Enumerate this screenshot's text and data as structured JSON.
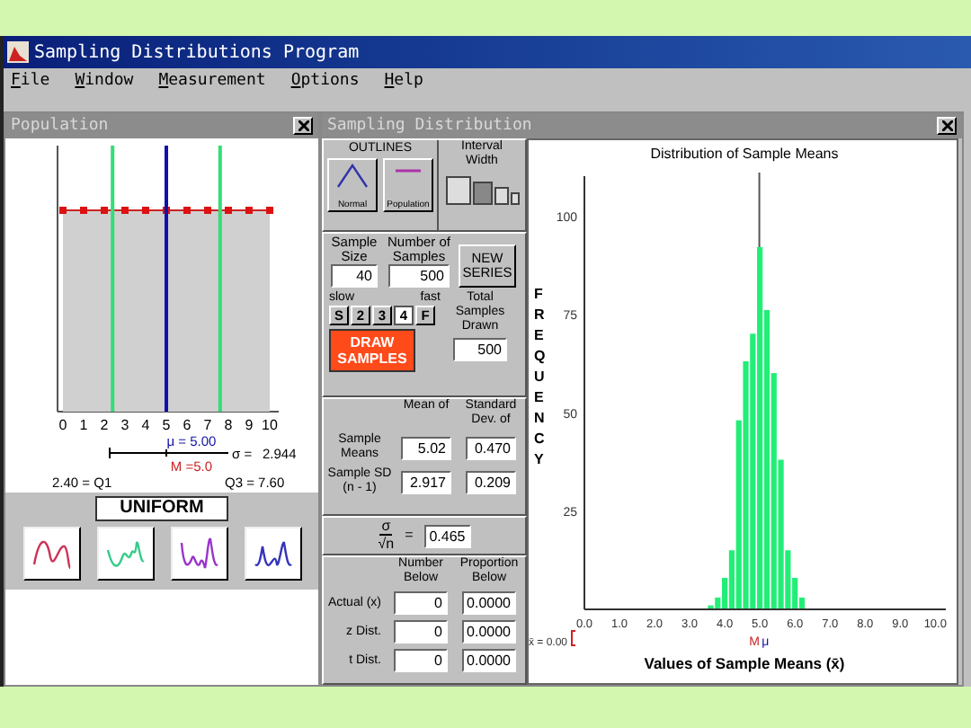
{
  "app": {
    "title": "Sampling Distributions Program"
  },
  "menu": [
    "File",
    "Window",
    "Measurement",
    "Options",
    "Help"
  ],
  "population": {
    "title": "Population",
    "axis_labels": [
      "0",
      "1",
      "2",
      "3",
      "4",
      "5",
      "6",
      "7",
      "8",
      "9",
      "10"
    ],
    "mu_label": "μ = 5.00",
    "sigma_label": "σ =",
    "sigma_value": "2.944",
    "median_label": "M =5.0",
    "q1_label": "2.40 = Q1",
    "q3_label": "Q3 = 7.60",
    "shape_name": "UNIFORM",
    "shape_buttons": [
      {
        "color": "#cc3355"
      },
      {
        "color": "#33cc88"
      },
      {
        "color": "#9933cc"
      },
      {
        "color": "#3333bb"
      }
    ]
  },
  "sampling": {
    "title": "Sampling Distribution",
    "outlines": {
      "label": "OUTLINES",
      "buttons": [
        {
          "label": "Normal",
          "kind": "curve"
        },
        {
          "label": "Population",
          "kind": "flat"
        }
      ]
    },
    "interval": {
      "label": "Interval Width",
      "options": [
        {
          "selected": false
        },
        {
          "selected": true
        },
        {
          "selected": false
        },
        {
          "selected": false
        }
      ]
    },
    "sample_size": {
      "label": "Sample Size",
      "value": "40"
    },
    "num_samples": {
      "label": "Number of Samples",
      "value": "500"
    },
    "new_series": "NEW SERIES",
    "speed": {
      "slow": "slow",
      "fast": "fast",
      "buttons": [
        {
          "label": "S",
          "selected": false
        },
        {
          "label": "2",
          "selected": false
        },
        {
          "label": "3",
          "selected": false
        },
        {
          "label": "4",
          "selected": true
        },
        {
          "label": "F",
          "selected": false
        }
      ]
    },
    "draw": "DRAW SAMPLES",
    "total": {
      "label": "Total Samples Drawn",
      "value": "500"
    },
    "stats": {
      "columns": [
        "Mean of",
        "Standard Dev. of"
      ],
      "rows": [
        {
          "label": "Sample Means",
          "values": [
            "5.02",
            "0.470"
          ]
        },
        {
          "label": "Sample SD (n - 1)",
          "values": [
            "2.917",
            "0.209"
          ]
        }
      ]
    },
    "se": {
      "numerator": "σ",
      "denominator": "√n",
      "equals": "=",
      "value": "0.465"
    },
    "below": {
      "columns": [
        "Number Below",
        "Proportion Below"
      ],
      "rows": [
        {
          "label": "Actual (x)",
          "values": [
            "0",
            "0.0000"
          ]
        },
        {
          "label": "z Dist.",
          "values": [
            "0",
            "0.0000"
          ]
        },
        {
          "label": "t Dist.",
          "values": [
            "0",
            "0.0000"
          ]
        }
      ]
    },
    "chart": {
      "start_label": "x̄ = 0.00",
      "median_mark": "M",
      "mean_mark": "μ",
      "chart_data": {
        "type": "bar",
        "title": "Distribution of Sample Means",
        "xlabel": "Values of Sample Means (x̄)",
        "ylabel": "FREQUENCY",
        "x": [
          3.6,
          3.8,
          4.0,
          4.2,
          4.4,
          4.6,
          4.8,
          5.0,
          5.2,
          5.4,
          5.6,
          5.8,
          6.0,
          6.2
        ],
        "values": [
          1,
          3,
          8,
          15,
          48,
          63,
          70,
          92,
          76,
          60,
          38,
          15,
          8,
          3
        ],
        "xlim": [
          0,
          10.3
        ],
        "ylim": [
          0,
          110
        ],
        "xticks": [
          {
            "value": 0,
            "label": "0.0"
          },
          {
            "value": 1,
            "label": "1.0"
          },
          {
            "value": 2,
            "label": "2.0"
          },
          {
            "value": 3,
            "label": "3.0"
          },
          {
            "value": 4,
            "label": "4.0"
          },
          {
            "value": 5,
            "label": "5.0"
          },
          {
            "value": 6,
            "label": "6.0"
          },
          {
            "value": 7,
            "label": "7.0"
          },
          {
            "value": 8,
            "label": "8.0"
          },
          {
            "value": 9,
            "label": "9.0"
          },
          {
            "value": 10,
            "label": "10.0"
          }
        ],
        "yticks": [
          25,
          50,
          75,
          100
        ]
      }
    }
  }
}
